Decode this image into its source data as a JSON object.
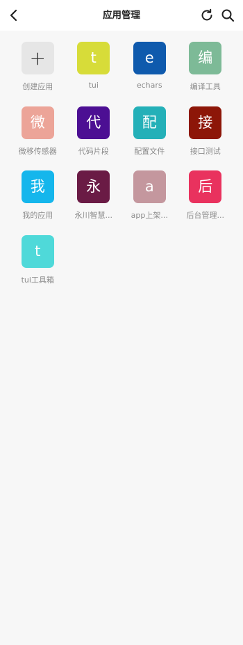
{
  "header": {
    "title": "应用管理",
    "back_icon": "chevron-left-icon",
    "refresh_icon": "refresh-icon",
    "search_icon": "search-icon"
  },
  "apps": [
    {
      "icon_text": "+",
      "label": "创建应用",
      "color": "#e6e6e6",
      "text_color": "#333333"
    },
    {
      "icon_text": "t",
      "label": "tui",
      "color": "#d7dc39"
    },
    {
      "icon_text": "e",
      "label": "echars",
      "color": "#0f5aad"
    },
    {
      "icon_text": "编",
      "label": "编译工具",
      "color": "#7dba97"
    },
    {
      "icon_text": "微",
      "label": "微移传感器",
      "color": "#eca498"
    },
    {
      "icon_text": "代",
      "label": "代码片段",
      "color": "#4c0f93"
    },
    {
      "icon_text": "配",
      "label": "配置文件",
      "color": "#24b0b8"
    },
    {
      "icon_text": "接",
      "label": "接口测试",
      "color": "#8d1608"
    },
    {
      "icon_text": "我",
      "label": "我的应用",
      "color": "#15b6ec"
    },
    {
      "icon_text": "永",
      "label": "永川智慧...",
      "color": "#6a1b45"
    },
    {
      "icon_text": "a",
      "label": "app上架...",
      "color": "#c4979e"
    },
    {
      "icon_text": "后",
      "label": "后台管理...",
      "color": "#e9325e"
    },
    {
      "icon_text": "t",
      "label": "tui工具箱",
      "color": "#4fd9d9"
    }
  ]
}
